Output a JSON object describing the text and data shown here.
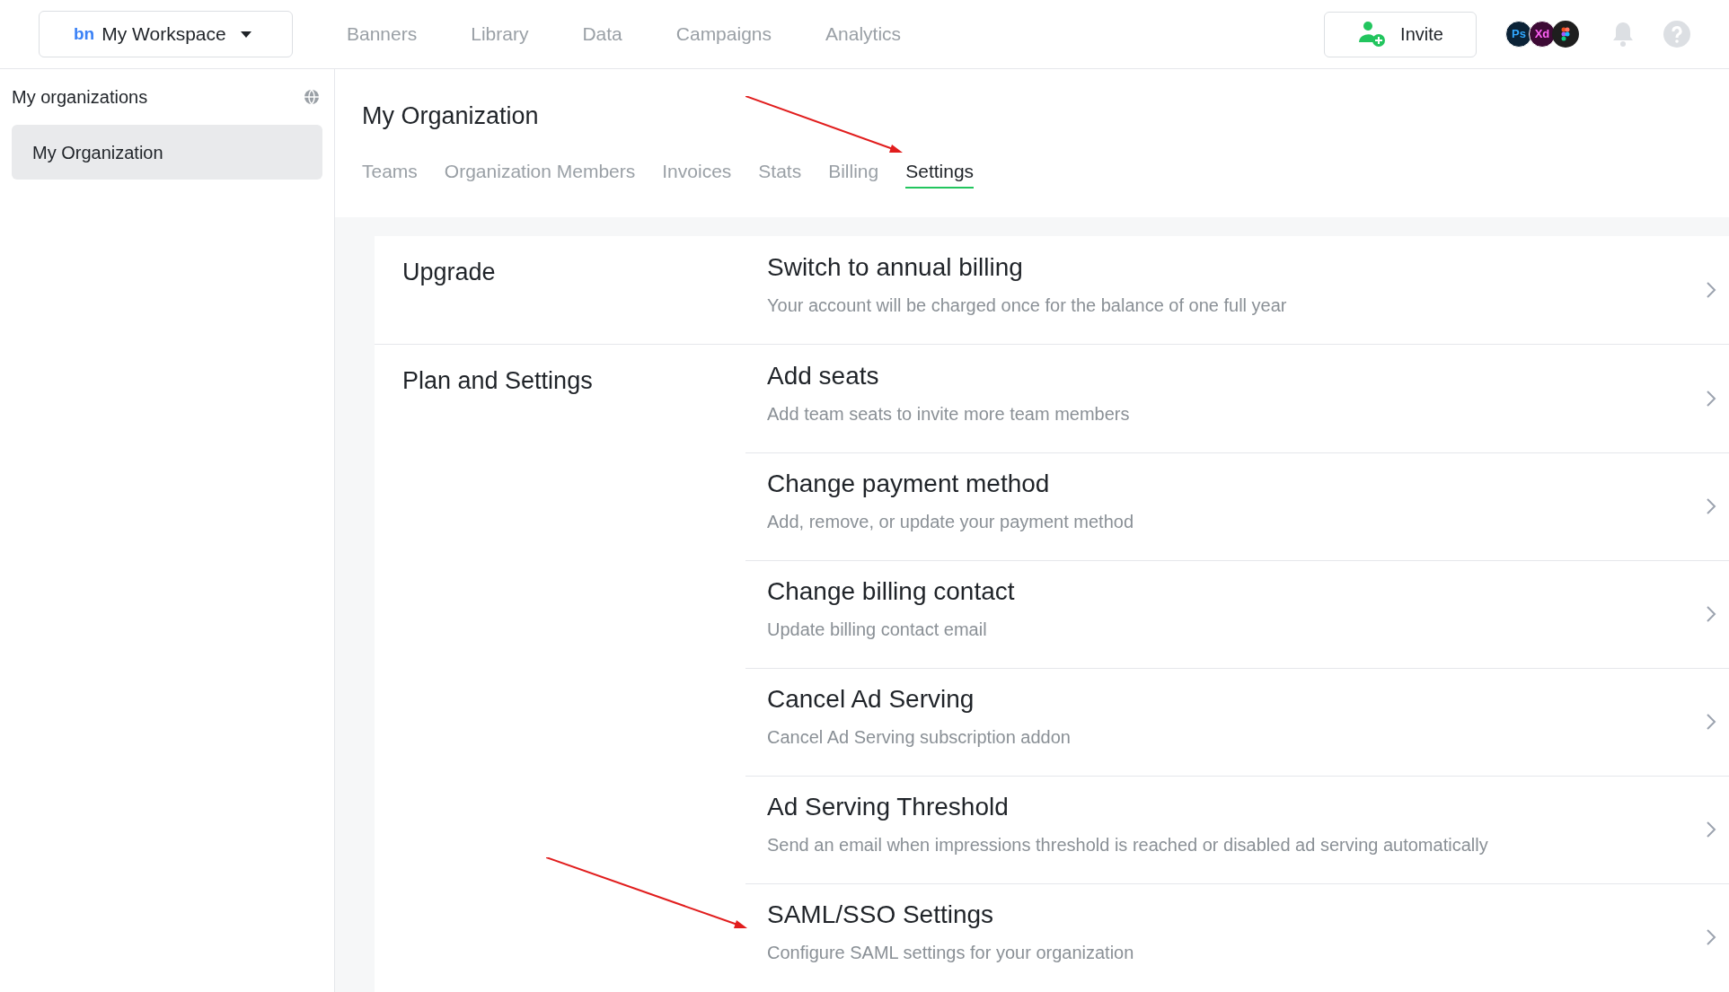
{
  "topbar": {
    "logo": "bn",
    "workspace": "My Workspace",
    "nav": [
      {
        "label": "Banners",
        "selected": false
      },
      {
        "label": "Library",
        "selected": false
      },
      {
        "label": "Data",
        "selected": false
      },
      {
        "label": "Campaigns",
        "selected": false
      },
      {
        "label": "Analytics",
        "selected": false
      }
    ],
    "invite": "Invite",
    "integrations": [
      {
        "label": "Ps",
        "color": "#0b2236"
      },
      {
        "label": "Xd",
        "color": "#3d0a35"
      }
    ]
  },
  "sidebar": {
    "title": "My organizations",
    "items": [
      {
        "label": "My Organization",
        "selected": true
      }
    ]
  },
  "page": {
    "title": "My Organization",
    "tabs": [
      {
        "label": "Teams",
        "selected": false
      },
      {
        "label": "Organization Members",
        "selected": false
      },
      {
        "label": "Invoices",
        "selected": false
      },
      {
        "label": "Stats",
        "selected": false
      },
      {
        "label": "Billing",
        "selected": false
      },
      {
        "label": "Settings",
        "selected": true
      }
    ]
  },
  "sections": [
    {
      "title": "Upgrade",
      "items": [
        {
          "title": "Switch to annual billing",
          "description": "Your account will be charged once for the balance of one full year"
        }
      ]
    },
    {
      "title": "Plan and Settings",
      "items": [
        {
          "title": "Add seats",
          "description": "Add team seats to invite more team members"
        },
        {
          "title": "Change payment method",
          "description": "Add, remove, or update your payment method"
        },
        {
          "title": "Change billing contact",
          "description": "Update billing contact email"
        },
        {
          "title": "Cancel Ad Serving",
          "description": "Cancel Ad Serving subscription addon"
        },
        {
          "title": "Ad Serving Threshold",
          "description": "Send an email when impressions threshold is reached or disabled ad serving automatically"
        },
        {
          "title": "SAML/SSO Settings",
          "description": "Configure SAML settings for your organization"
        }
      ]
    }
  ]
}
